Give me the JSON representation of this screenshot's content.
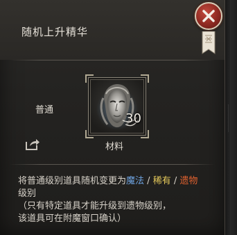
{
  "window": {
    "title": "随机上升精华"
  },
  "item": {
    "quality": "普通",
    "quantity": "30",
    "type": "材料"
  },
  "description": {
    "line1_prefix": "将普通级别道具随机变更为",
    "magic": "魔法",
    "sep1": " / ",
    "rare": "稀有",
    "sep2": " / ",
    "relic": "遗物",
    "line2": "级别",
    "line3": "（只有特定道具才能升级到遗物级别，",
    "line4": "该道具可在附魔窗口确认）"
  },
  "icons": {
    "close": "close-icon",
    "share": "share-icon",
    "item": "essence-mask-icon",
    "banner": "banner-icon"
  },
  "colors": {
    "magic": "#6ea3e0",
    "rare": "#e3c75a",
    "relic": "#e0612f",
    "close_button": "#a8342a"
  }
}
